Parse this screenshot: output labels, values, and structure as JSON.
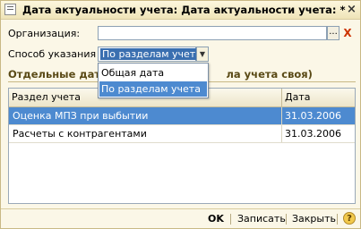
{
  "window": {
    "title": "Дата актуальности учета: Дата актуальности учета: *",
    "close_label": "×"
  },
  "form": {
    "org_label": "Организация:",
    "org_value": "",
    "dots_label": "...",
    "clear_label": "X",
    "mode_label": "Способ указания :",
    "mode_value": "По разделам учета",
    "dropdown_arrow": "▼",
    "dropdown_options": [
      "Общая дата",
      "По разделам учета"
    ],
    "section_title_left": "Отдельные даты",
    "section_title_right": "ла учета своя)"
  },
  "grid": {
    "columns": [
      "Раздел учета",
      "Дата"
    ],
    "rows": [
      {
        "section": "Оценка МПЗ при выбытии",
        "date": "31.03.2006",
        "selected": true
      },
      {
        "section": "Расчеты с контрагентами",
        "date": "31.03.2006",
        "selected": false
      }
    ]
  },
  "footer": {
    "ok": "OK",
    "save": "Записать",
    "close": "Закрыть",
    "help": "?"
  },
  "colors": {
    "window_bg": "#fbf7e7",
    "selection": "#4d8ad0",
    "section_title": "#5a4a16"
  }
}
